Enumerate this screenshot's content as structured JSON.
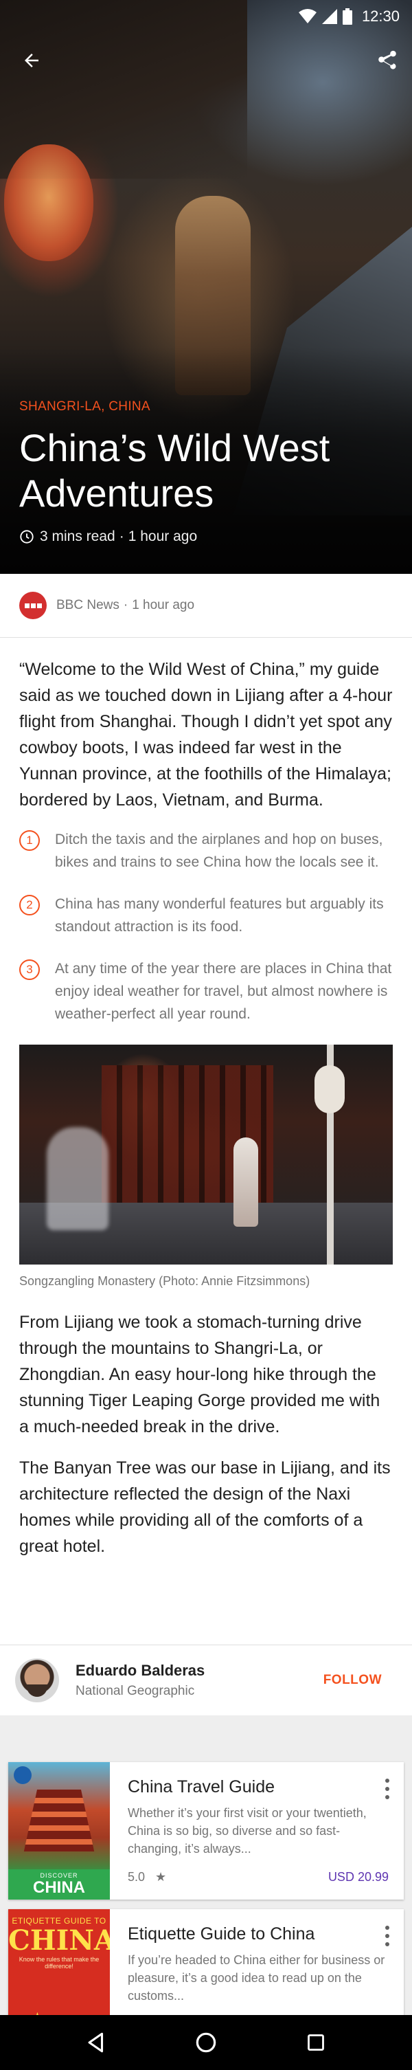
{
  "status_bar": {
    "time": "12:30"
  },
  "hero": {
    "location": "SHANGRI-LA, CHINA",
    "title": "China’s Wild West Adventures",
    "read_time": "3 mins read",
    "separator": "·",
    "published": "1 hour ago"
  },
  "source": {
    "name": "BBC News",
    "separator": "·",
    "published": "1 hour ago"
  },
  "article": {
    "intro": "“Welcome to the Wild West of China,” my guide said as we touched down in Lijiang after a 4-hour flight from Shanghai. Though I didn’t yet spot any cowboy boots, I was indeed far west in the Yunnan province, at the foothills of the Himalaya; bordered by Laos, Vietnam, and Burma.",
    "tips": [
      {
        "num": "1",
        "text": "Ditch the taxis and the airplanes and hop on buses, bikes and trains to see China how the locals see it."
      },
      {
        "num": "2",
        "text": "China has many wonderful features but arguably its standout attraction is its food."
      },
      {
        "num": "3",
        "text": "At any time of the year there are places in China that enjoy ideal weather for travel, but almost nowhere is weather-perfect all year round."
      }
    ],
    "photo_caption": "Songzangling Monastery (Photo: Annie Fitzsimmons)",
    "paragraph2": "From Lijiang we took a stomach-turning drive through the mountains to Shangri-La, or Zhongdian. An easy hour-long hike through the stunning Tiger Leaping Gorge provided me with a much-needed break in the drive.",
    "paragraph3": "The Banyan Tree was our base in Lijiang, and its architecture reflected the design of the Naxi homes while providing all of the comforts of a great hotel."
  },
  "author": {
    "name": "Eduardo Balderas",
    "organization": "National Geographic",
    "follow_label": "FOLLOW"
  },
  "products": [
    {
      "title": "China Travel Guide",
      "description": "Whether it’s your first visit or your twentieth, China is so big, so diverse and so fast-changing, it’s always...",
      "rating": "5.0",
      "rating_icon": "★",
      "price": "USD 20.99",
      "cover": {
        "kicker": "DISCOVER",
        "title": "CHINA"
      }
    },
    {
      "title": "Etiquette Guide to China",
      "description": "If you’re headed to China either for business or pleasure, it’s a good idea to read up on the customs...",
      "cover": {
        "kicker": "ETIQUETTE GUIDE TO",
        "title": "CHINA",
        "subtitle": "Know the rules that make the difference!"
      }
    }
  ],
  "colors": {
    "accent": "#f4511e",
    "price": "#5e35b1",
    "bbc_red": "#d32f2f"
  },
  "icons": {
    "back": "arrow-left-icon",
    "share": "share-icon",
    "clock": "clock-icon",
    "more": "more-vert-icon",
    "nav_back": "triangle-back-icon",
    "nav_home": "circle-home-icon",
    "nav_recents": "square-recents-icon"
  }
}
